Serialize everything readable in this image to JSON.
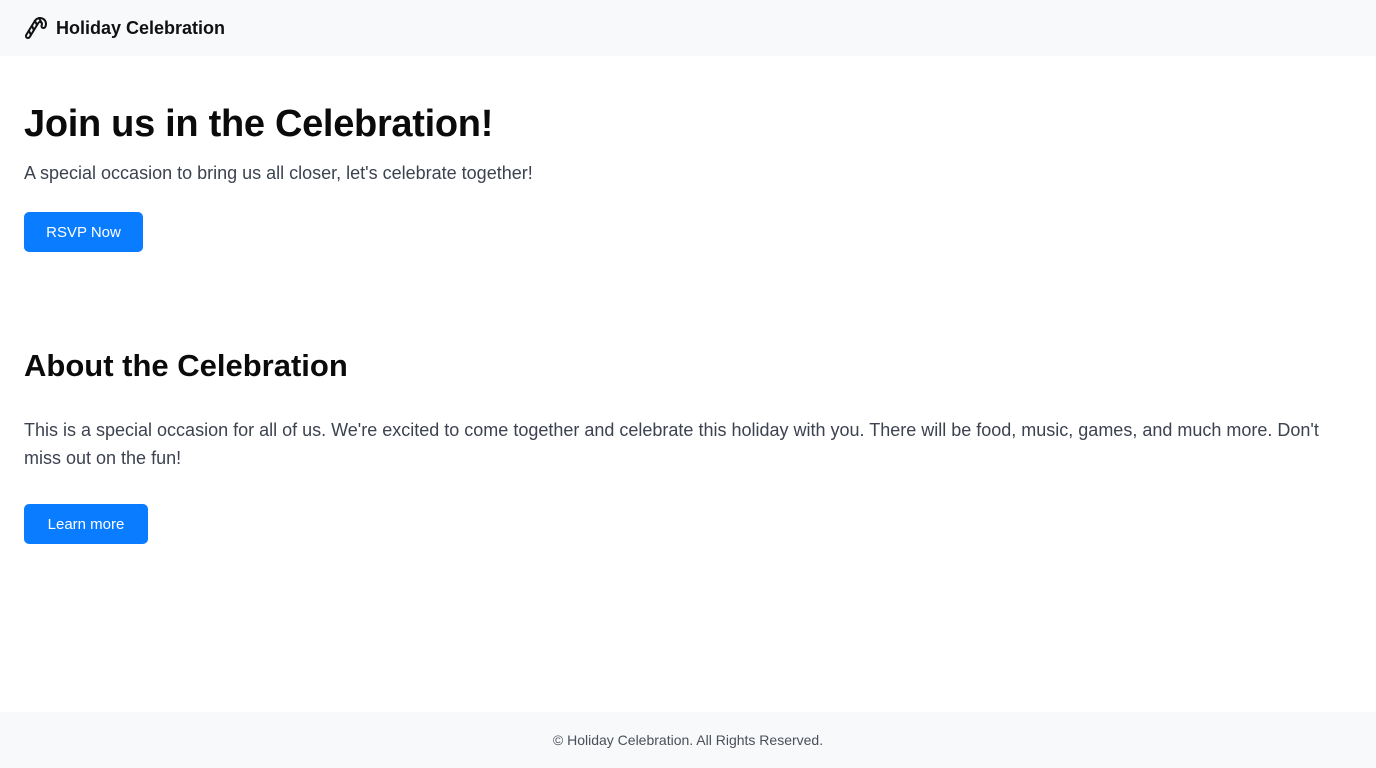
{
  "header": {
    "brand_icon": "candy-cane-icon",
    "brand_name": "Holiday Celebration"
  },
  "hero": {
    "title": "Join us in the Celebration!",
    "subtitle": "A special occasion to bring us all closer, let's celebrate together!",
    "cta_label": "RSVP Now"
  },
  "about": {
    "title": "About the Celebration",
    "body": "This is a special occasion for all of us. We're excited to come together and celebrate this holiday with you. There will be food, music, games, and much more. Don't miss out on the fun!",
    "cta_label": "Learn more"
  },
  "footer": {
    "text": "© Holiday Celebration. All Rights Reserved."
  },
  "colors": {
    "accent": "#0a7cff",
    "header_bg": "#f8f9fb",
    "footer_bg": "#f8f9fb",
    "body_text": "#3c4250",
    "heading_text": "#0b0b0b"
  }
}
